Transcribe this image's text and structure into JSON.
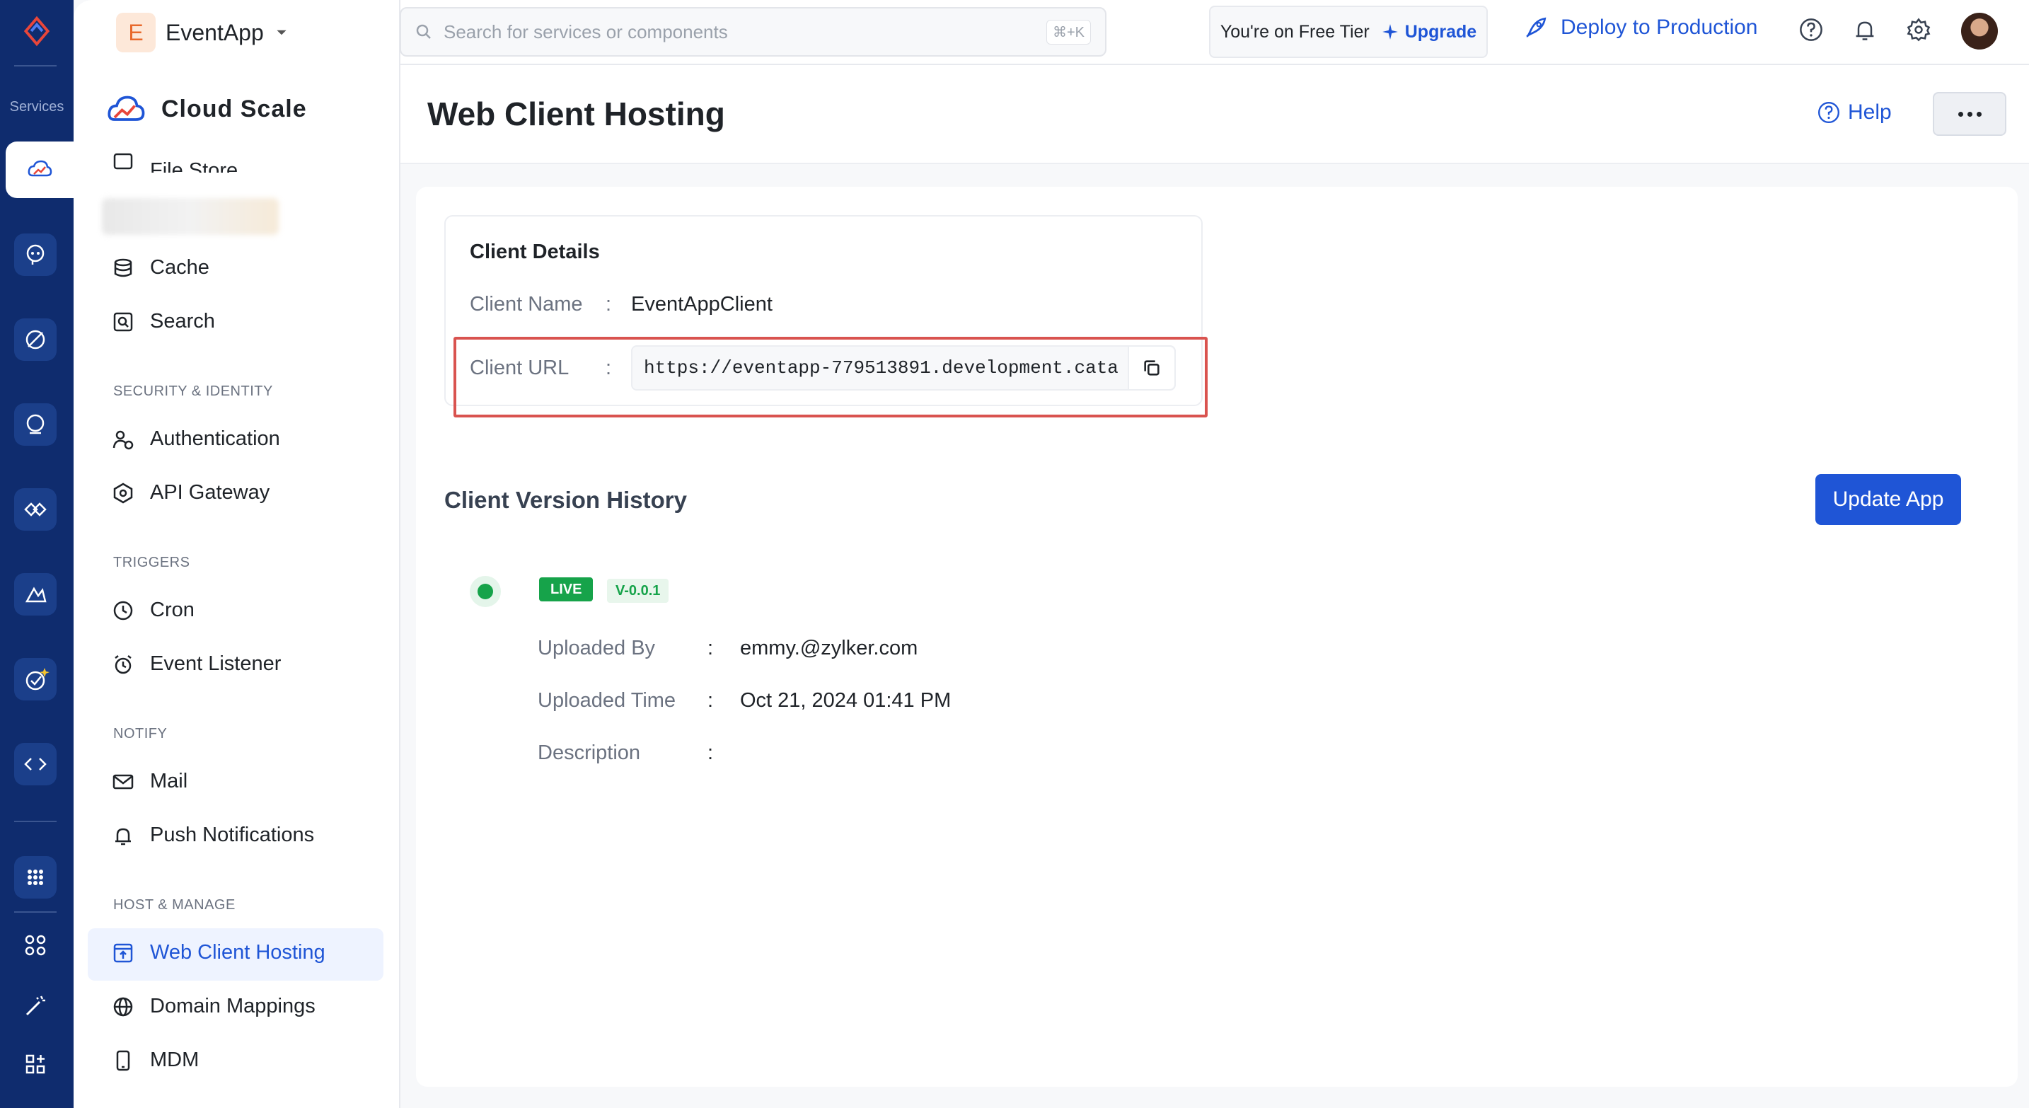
{
  "rail": {
    "services_label": "Services"
  },
  "project": {
    "initial": "E",
    "name": "EventApp"
  },
  "sidebar": {
    "section_title": "Cloud Scale",
    "partial_item": "File Store",
    "items_top": [
      {
        "label": "Cache",
        "icon": "database-icon"
      },
      {
        "label": "Search",
        "icon": "search-box-icon"
      }
    ],
    "sec_security": "SECURITY & IDENTITY",
    "items_security": [
      {
        "label": "Authentication",
        "icon": "users-icon"
      },
      {
        "label": "API Gateway",
        "icon": "gateway-icon"
      }
    ],
    "sec_triggers": "TRIGGERS",
    "items_triggers": [
      {
        "label": "Cron",
        "icon": "clock-icon"
      },
      {
        "label": "Event Listener",
        "icon": "alarm-icon"
      }
    ],
    "sec_notify": "NOTIFY",
    "items_notify": [
      {
        "label": "Mail",
        "icon": "mail-icon"
      },
      {
        "label": "Push Notifications",
        "icon": "bell-icon"
      }
    ],
    "sec_host": "HOST & MANAGE",
    "items_host": [
      {
        "label": "Web Client Hosting",
        "icon": "upload-window-icon",
        "active": true
      },
      {
        "label": "Domain Mappings",
        "icon": "globe-icon"
      },
      {
        "label": "MDM",
        "icon": "phone-icon"
      }
    ]
  },
  "topbar": {
    "search_placeholder": "Search for services or components",
    "search_shortcut": "⌘+K",
    "tier_text": "You're on Free Tier",
    "upgrade_label": "Upgrade",
    "deploy_label": "Deploy to Production"
  },
  "page": {
    "title": "Web Client Hosting",
    "help_label": "Help"
  },
  "client_details": {
    "title": "Client Details",
    "name_label": "Client Name",
    "name_value": "EventAppClient",
    "url_label": "Client URL",
    "url_value": "https://eventapp-779513891.development.cata",
    "colon": ":"
  },
  "history": {
    "title": "Client Version History",
    "update_button": "Update App",
    "status_badge": "LIVE",
    "version": "V-0.0.1",
    "uploaded_by_label": "Uploaded By",
    "uploaded_by_value": "emmy.@zylker.com",
    "uploaded_time_label": "Uploaded Time",
    "uploaded_time_value": "Oct 21, 2024 01:41 PM",
    "description_label": "Description",
    "description_value": "",
    "colon": ":"
  },
  "colors": {
    "rail_bg": "#0f2c6e",
    "accent": "#1f55d6",
    "live": "#16a34a",
    "highlight": "#d9534f"
  }
}
